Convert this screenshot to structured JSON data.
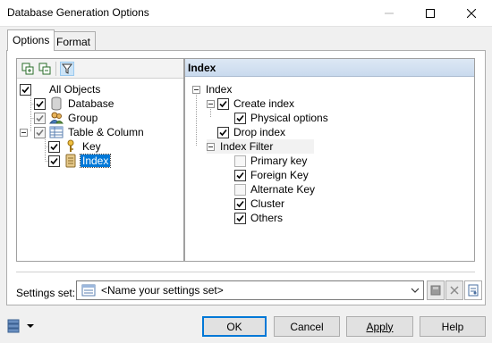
{
  "window": {
    "title": "Database Generation Options",
    "min_icon": "minimize-icon",
    "max_icon": "maximize-icon",
    "close_icon": "close-icon"
  },
  "tabs": [
    {
      "label": "Options",
      "active": true
    },
    {
      "label": "Format",
      "active": false
    }
  ],
  "left_tree": {
    "toolbar_icons": [
      "expand-all-icon",
      "collapse-all-icon",
      "filter-icon"
    ],
    "items": [
      {
        "label": "All Objects",
        "checked": true
      },
      {
        "label": "Database",
        "checked": true,
        "icon": "database-icon"
      },
      {
        "label": "Group",
        "checked": true,
        "partial": true,
        "icon": "group-icon"
      },
      {
        "label": "Table & Column",
        "checked": true,
        "partial": true,
        "icon": "table-icon"
      },
      {
        "label": "Key",
        "checked": true,
        "icon": "key-icon"
      },
      {
        "label": "Index",
        "checked": true,
        "selected": true,
        "icon": "index-icon"
      }
    ]
  },
  "right_pane": {
    "header": "Index",
    "items": [
      {
        "label": "Index",
        "type": "group"
      },
      {
        "label": "Create index",
        "checked": true
      },
      {
        "label": "Physical options",
        "checked": true
      },
      {
        "label": "Drop index",
        "checked": true
      },
      {
        "label": "Index Filter",
        "type": "group"
      },
      {
        "label": "Primary key",
        "checked": false
      },
      {
        "label": "Foreign Key",
        "checked": true
      },
      {
        "label": "Alternate Key",
        "checked": false
      },
      {
        "label": "Cluster",
        "checked": true
      },
      {
        "label": "Others",
        "checked": true
      }
    ]
  },
  "settings": {
    "label": "Settings set:",
    "value": "<Name your settings set>"
  },
  "buttons": {
    "ok": "OK",
    "cancel": "Cancel",
    "apply": "Apply",
    "help": "Help"
  },
  "colors": {
    "selection": "#0078d7",
    "header_gradient_top": "#dde8f4",
    "header_gradient_bottom": "#c9daee"
  }
}
